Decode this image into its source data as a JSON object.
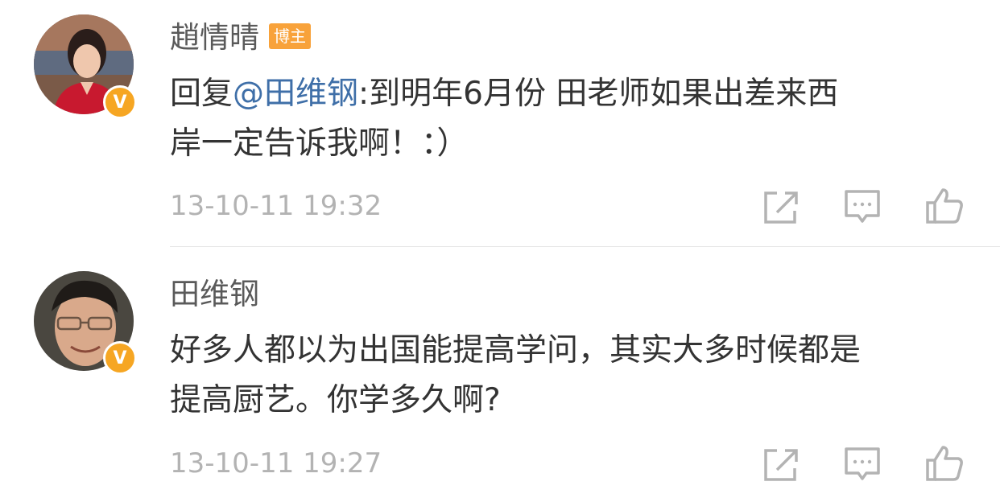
{
  "comments": [
    {
      "author": "趙情晴",
      "tag": "博主",
      "verified_mark": "V",
      "reply_prefix": "回复",
      "mention": "@田维钢",
      "line1_rest": ":到明年6月份 田老师如果出差来西",
      "line2": "岸一定告诉我啊！：）",
      "time": "13-10-11 19:32",
      "avatar_icon": "woman-avatar",
      "actions": [
        "share-icon",
        "comment-icon",
        "like-icon"
      ]
    },
    {
      "author": "田维钢",
      "verified_mark": "V",
      "line1": "好多人都以为出国能提高学问，其实大多时候都是",
      "line2": "提高厨艺。你学多久啊?",
      "time": "13-10-11 19:27",
      "avatar_icon": "man-avatar",
      "actions": [
        "share-icon",
        "comment-icon",
        "like-icon"
      ]
    }
  ],
  "colors": {
    "mention": "#3f6fa8",
    "tag": "#f8a23a",
    "badge": "#f6a623",
    "meta": "#b3b3b3"
  }
}
